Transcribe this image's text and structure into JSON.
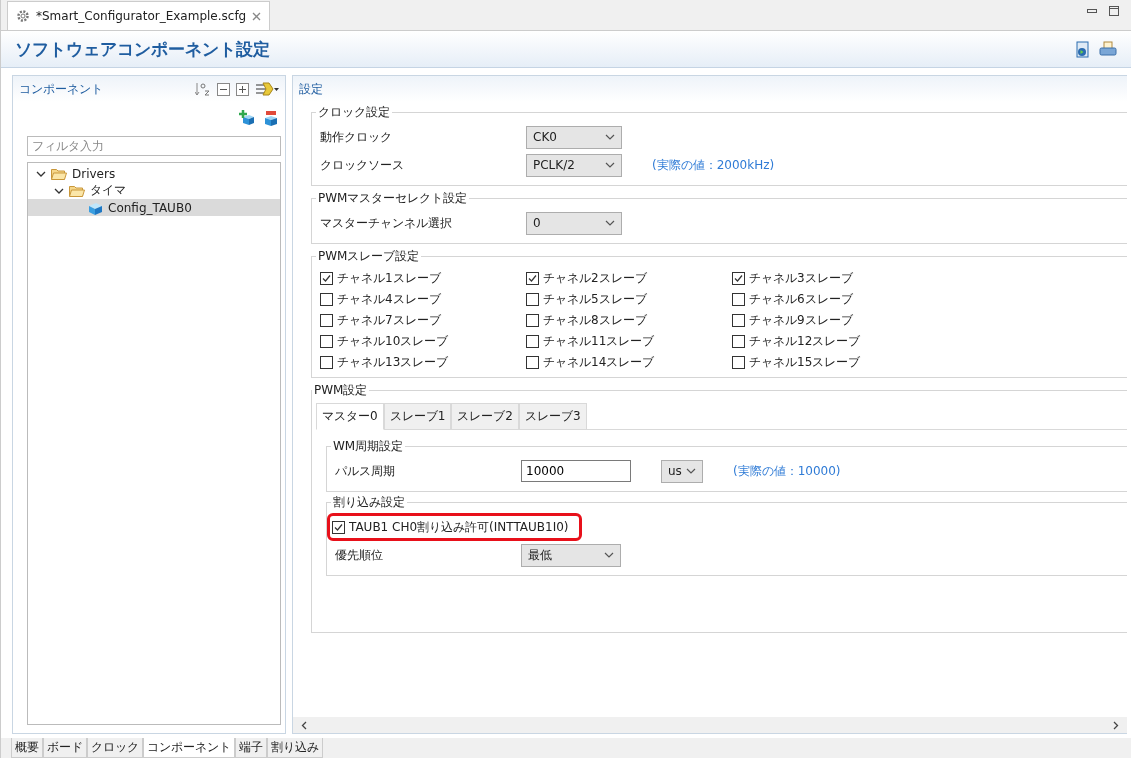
{
  "editor_tab": {
    "title": "*Smart_Configurator_Example.scfg"
  },
  "header": {
    "title": "ソフトウェアコンポーネント設定"
  },
  "components_panel": {
    "title": "コンポーネント",
    "filter_placeholder": "フィルタ入力",
    "tree": [
      {
        "label": "Drivers",
        "kind": "folder",
        "expanded": true,
        "selected": false,
        "children": [
          {
            "label": "タイマ",
            "kind": "folder",
            "expanded": true,
            "selected": false,
            "children": [
              {
                "label": "Config_TAUB0",
                "kind": "component",
                "selected": true
              }
            ]
          }
        ]
      }
    ]
  },
  "settings_panel": {
    "title": "設定",
    "clock_group": {
      "title": "クロック設定",
      "rows": [
        {
          "label": "動作クロック",
          "value": "CK0"
        },
        {
          "label": "クロックソース",
          "value": "PCLK/2",
          "note": "(実際の値：2000kHz)"
        }
      ]
    },
    "master_select_group": {
      "title": "PWMマスターセレクト設定",
      "rows": [
        {
          "label": "マスターチャンネル選択",
          "value": "0"
        }
      ]
    },
    "slave_group": {
      "title": "PWMスレーブ設定",
      "checkboxes": [
        {
          "label": "チャネル1スレーブ",
          "checked": true
        },
        {
          "label": "チャネル2スレーブ",
          "checked": true
        },
        {
          "label": "チャネル3スレーブ",
          "checked": true
        },
        {
          "label": "チャネル4スレーブ",
          "checked": false
        },
        {
          "label": "チャネル5スレーブ",
          "checked": false
        },
        {
          "label": "チャネル6スレーブ",
          "checked": false
        },
        {
          "label": "チャネル7スレーブ",
          "checked": false
        },
        {
          "label": "チャネル8スレーブ",
          "checked": false
        },
        {
          "label": "チャネル9スレーブ",
          "checked": false
        },
        {
          "label": "チャネル10スレーブ",
          "checked": false
        },
        {
          "label": "チャネル11スレーブ",
          "checked": false
        },
        {
          "label": "チャネル12スレーブ",
          "checked": false
        },
        {
          "label": "チャネル13スレーブ",
          "checked": false
        },
        {
          "label": "チャネル14スレーブ",
          "checked": false
        },
        {
          "label": "チャネル15スレーブ",
          "checked": false
        }
      ]
    },
    "pwm_group": {
      "title": "PWM設定",
      "tabs": [
        {
          "label": "マスター0",
          "selected": true
        },
        {
          "label": "スレーブ1",
          "selected": false
        },
        {
          "label": "スレーブ2",
          "selected": false
        },
        {
          "label": "スレーブ3",
          "selected": false
        }
      ],
      "period_group": {
        "title": "WM周期設定",
        "label": "パルス周期",
        "value": "10000",
        "unit": "us",
        "note": "(実際の値：10000)"
      },
      "interrupt_group": {
        "title": "割り込み設定",
        "checkbox": {
          "label": "TAUB1 CH0割り込み許可(INTTAUB1I0)",
          "checked": true,
          "highlighted": true
        },
        "priority": {
          "label": "優先順位",
          "value": "最低"
        }
      }
    }
  },
  "bottom_tabs": [
    {
      "label": "概要",
      "selected": false
    },
    {
      "label": "ボード",
      "selected": false
    },
    {
      "label": "クロック",
      "selected": false
    },
    {
      "label": "コンポーネント",
      "selected": true
    },
    {
      "label": "端子",
      "selected": false
    },
    {
      "label": "割り込み",
      "selected": false
    }
  ]
}
